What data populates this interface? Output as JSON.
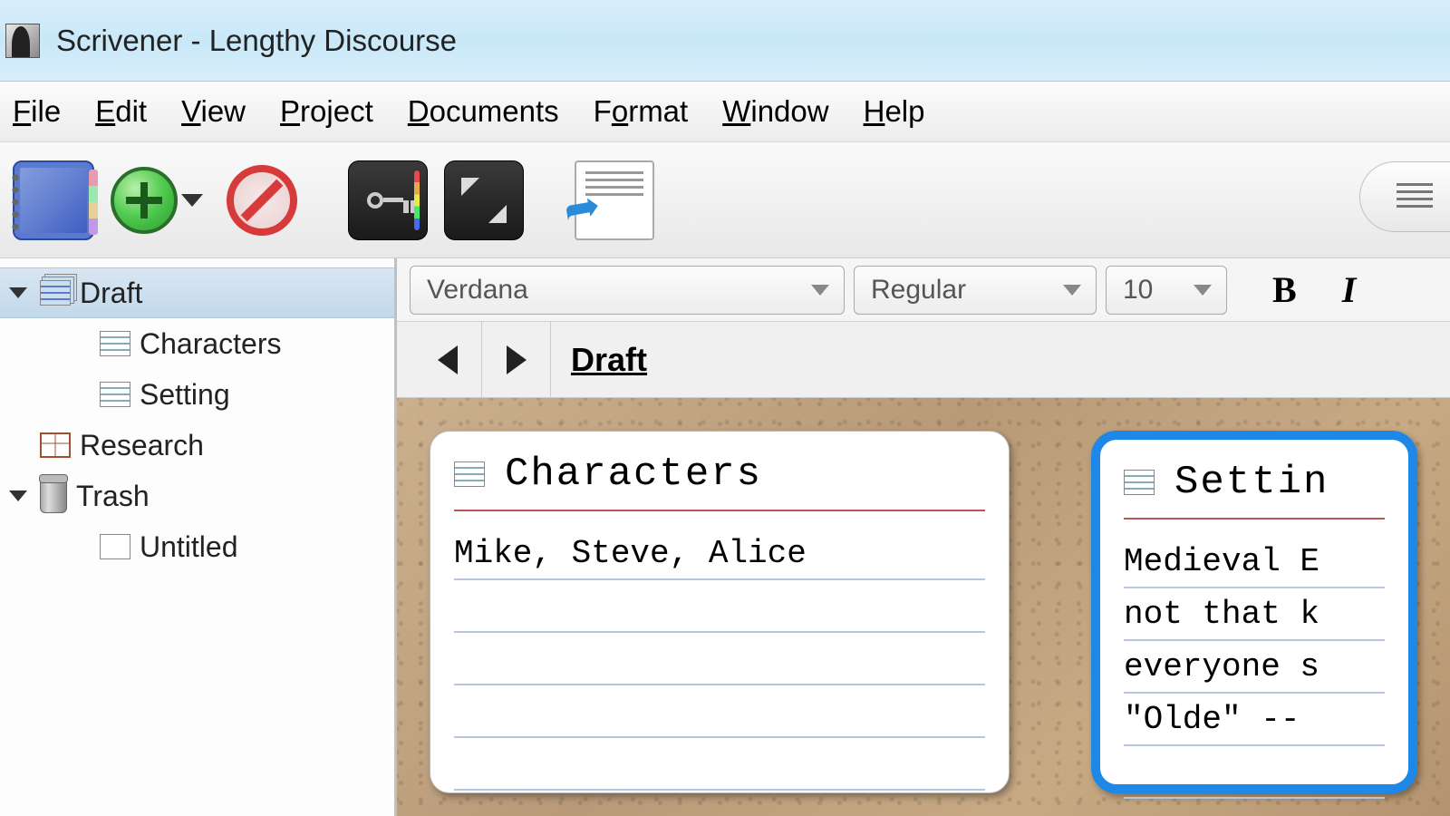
{
  "window": {
    "title": "Scrivener - Lengthy Discourse"
  },
  "menu": {
    "file": "File",
    "edit": "Edit",
    "view": "View",
    "project": "Project",
    "documents": "Documents",
    "format": "Format",
    "window": "Window",
    "help": "Help"
  },
  "binder": {
    "draft": "Draft",
    "characters": "Characters",
    "setting": "Setting",
    "research": "Research",
    "trash": "Trash",
    "untitled": "Untitled"
  },
  "format_bar": {
    "font": "Verdana",
    "style": "Regular",
    "size": "10",
    "bold": "B",
    "italic": "I"
  },
  "nav": {
    "crumb": "Draft"
  },
  "cards": {
    "c1": {
      "title": "Characters",
      "body": "Mike, Steve, Alice"
    },
    "c2": {
      "title": "Settin",
      "body": "Medieval E\nnot that k\neveryone s\n\"Olde\" -- "
    }
  }
}
